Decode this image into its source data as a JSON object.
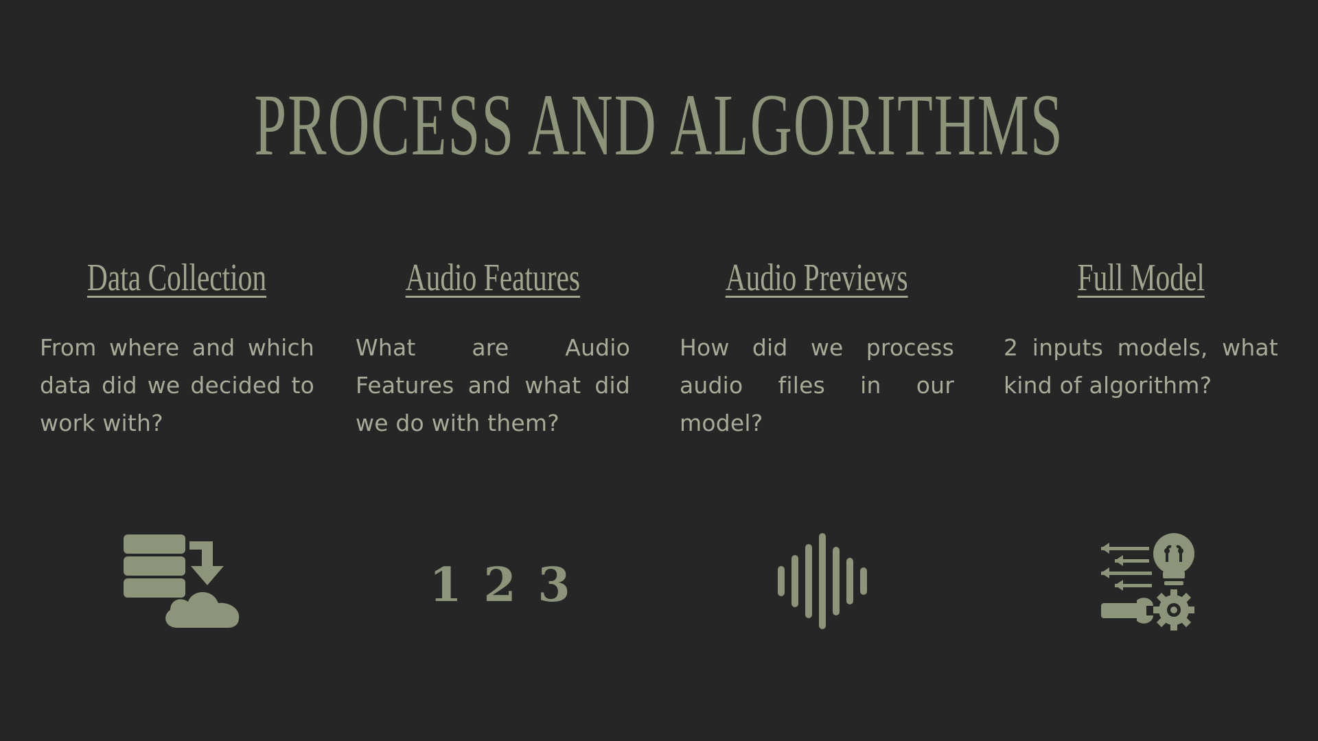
{
  "slide": {
    "title": "PROCESS AND ALGORITHMS"
  },
  "colors": {
    "background": "#262626",
    "title": "#8c9479",
    "icon": "#8c9479",
    "heading": "#a1a78f",
    "text": "#a6ac98"
  },
  "columns": [
    {
      "heading": "Data Collection",
      "text": "From where and which data did we decided to work with?",
      "icon": "database-cloud-download-icon"
    },
    {
      "heading": "Audio Features",
      "text": "What are Audio Features and what did we do with them?",
      "icon": "numbers-icon",
      "icon_text": "1 2 3"
    },
    {
      "heading": "Audio Previews",
      "text": "How did we process audio files in our model?",
      "icon": "sound-wave-icon"
    },
    {
      "heading": "Full Model",
      "text": "2 inputs models, what kind of algorithm?",
      "icon": "lightbulb-gear-tools-icon"
    }
  ]
}
